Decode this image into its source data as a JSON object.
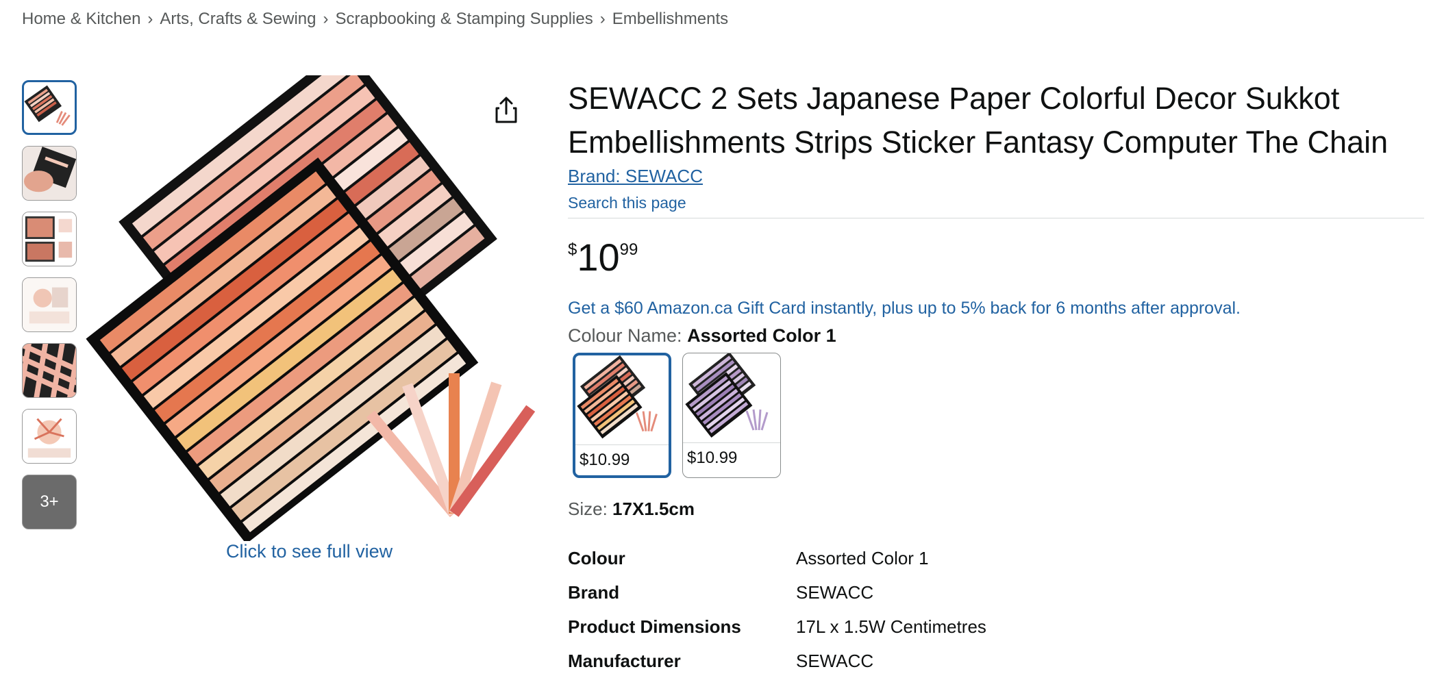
{
  "breadcrumb": [
    "Home & Kitchen",
    "Arts, Crafts & Sewing",
    "Scrapbooking & Stamping Supplies",
    "Embellishments"
  ],
  "breadcrumb_separator": "›",
  "thumbnails": {
    "count_visible": 6,
    "more_label": "3+"
  },
  "main_image": {
    "caption": "Click to see full view",
    "share_icon": "share-icon"
  },
  "product": {
    "title": "SEWACC 2 Sets Japanese Paper Colorful Decor Sukkot Embellishments Strips Sticker Fantasy Computer The Chain",
    "brand_link": "Brand: SEWACC",
    "search_page": "Search this page",
    "price": {
      "symbol": "$",
      "whole": "10",
      "fraction": "99"
    },
    "promo": "Get a $60 Amazon.ca Gift Card instantly, plus up to 5% back for 6 months after approval.",
    "colour_label": "Colour Name: ",
    "colour_value": "Assorted Color 1",
    "swatches": [
      {
        "price": "$10.99",
        "selected": true
      },
      {
        "price": "$10.99",
        "selected": false
      }
    ],
    "size_label": "Size: ",
    "size_value": "17X1.5cm",
    "specs": [
      {
        "key": "Colour",
        "value": "Assorted Color 1"
      },
      {
        "key": "Brand",
        "value": "SEWACC"
      },
      {
        "key": "Product Dimensions",
        "value": "17L x 1.5W Centimetres"
      },
      {
        "key": "Manufacturer",
        "value": "SEWACC"
      }
    ]
  },
  "colors": {
    "link": "#2162a1",
    "text": "#0f1111",
    "muted": "#565959",
    "selected_border": "#2162a1"
  }
}
